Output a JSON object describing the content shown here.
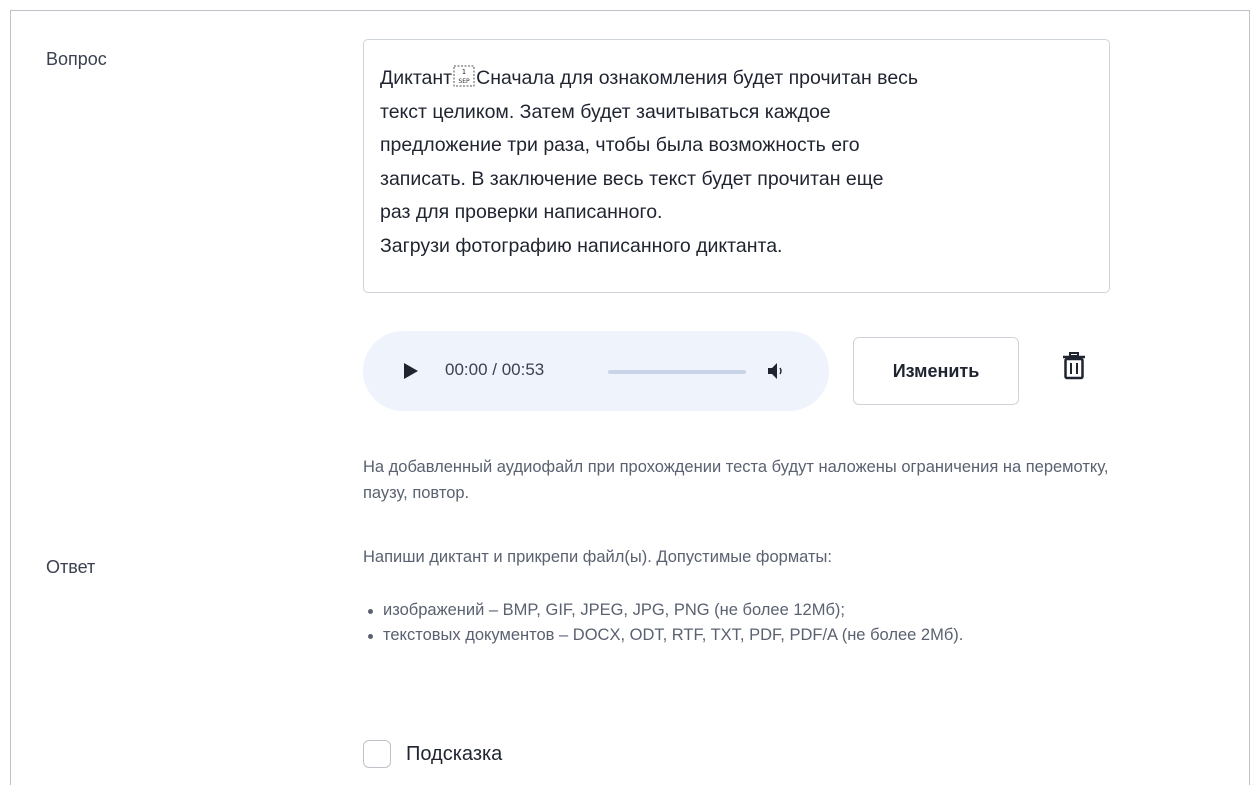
{
  "question": {
    "label": "Вопрос",
    "text_lines": [
      {
        "before": "Диктант",
        "sep_glyph": "SEP",
        "after": "Сначала для ознакомления будет прочитан весь"
      },
      "текст целиком. Затем будет зачитываться каждое",
      "предложение три раза, чтобы была возможность его",
      "записать. В заключение весь текст будет прочитан еще",
      "раз для проверки написанного.",
      "Загрузи фотографию написанного диктанта."
    ]
  },
  "audio": {
    "time": "00:00 / 00:53",
    "progress_fraction": 0,
    "play_icon": "play-icon",
    "volume_icon": "volume-icon"
  },
  "actions": {
    "change_label": "Изменить",
    "delete_icon": "trash-icon"
  },
  "audio_note": "На добавленный аудиофайл при прохождении теста будут наложены ограничения на перемотку, паузу, повтор.",
  "answer": {
    "label": "Ответ",
    "intro": "Напиши диктант и прикрепи файл(ы). Допустимые форматы:",
    "formats": [
      "изображений – BMP, GIF, JPEG, JPG, PNG (не более 12Мб);",
      "текстовых документов – DOCX, ODT, RTF, TXT, PDF, PDF/A (не более 2Мб)."
    ]
  },
  "hint": {
    "label": "Подсказка",
    "checked": false
  },
  "colors": {
    "text": "#1f2430",
    "muted": "#5a6170",
    "border": "#cfd3da",
    "audio_bg": "#eef3fc"
  }
}
